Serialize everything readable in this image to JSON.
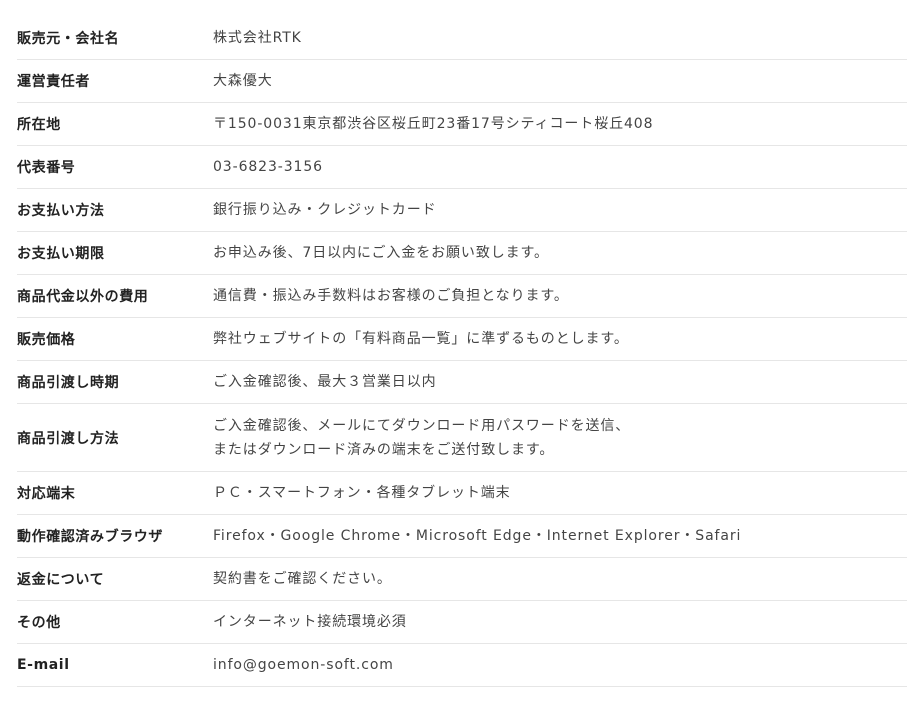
{
  "rows": [
    {
      "label": "販売元・会社名",
      "value": [
        "株式会社RTK"
      ]
    },
    {
      "label": "運営責任者",
      "value": [
        "大森優大"
      ]
    },
    {
      "label": "所在地",
      "value": [
        "〒150-0031東京都渋谷区桜丘町23番17号シティコート桜丘408"
      ]
    },
    {
      "label": "代表番号",
      "value": [
        "03-6823-3156"
      ]
    },
    {
      "label": "お支払い方法",
      "value": [
        "銀行振り込み・クレジットカード"
      ]
    },
    {
      "label": "お支払い期限",
      "value": [
        "お申込み後、7日以内にご入金をお願い致します。"
      ]
    },
    {
      "label": "商品代金以外の費用",
      "value": [
        "通信費・振込み手数料はお客様のご負担となります。"
      ]
    },
    {
      "label": "販売価格",
      "value": [
        "弊社ウェブサイトの「有料商品一覧」に準ずるものとします。"
      ]
    },
    {
      "label": "商品引渡し時期",
      "value": [
        "ご入金確認後、最大３営業日以内"
      ]
    },
    {
      "label": "商品引渡し方法",
      "value": [
        "ご入金確認後、メールにてダウンロード用パスワードを送信、",
        "またはダウンロード済みの端末をご送付致します。"
      ]
    },
    {
      "label": "対応端末",
      "value": [
        "ＰＣ・スマートフォン・各種タブレット端末"
      ]
    },
    {
      "label": "動作確認済みブラウザ",
      "value": [
        "Firefox・Google Chrome・Microsoft Edge・Internet Explorer・Safari"
      ]
    },
    {
      "label": "返金について",
      "value": [
        "契約書をご確認ください。"
      ]
    },
    {
      "label": "その他",
      "value": [
        "インターネット接続環境必須"
      ]
    },
    {
      "label": "E-mail",
      "value": [
        "info@goemon-soft.com"
      ]
    }
  ]
}
